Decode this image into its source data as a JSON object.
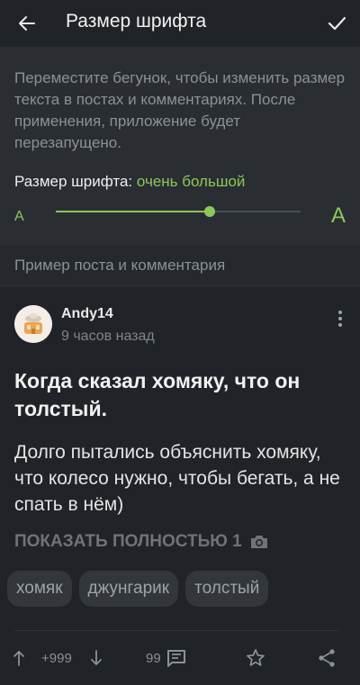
{
  "appbar": {
    "title": "Размер шрифта",
    "back_icon": "arrow-left-icon",
    "confirm_icon": "check-icon"
  },
  "settings": {
    "description": "Переместите бегунок, чтобы изменить размер текста в постах и комментариях. После применения, приложение будет перезапущено.",
    "size_label": "Размер шрифта:",
    "size_value": "очень большой",
    "min_glyph": "A",
    "max_glyph": "A",
    "slider_fraction": 0.63,
    "accent": "#8ac858"
  },
  "preview": {
    "section_title": "Пример поста и комментария",
    "author": "Andy14",
    "time": "9 часов назад",
    "title": "Когда сказал хомяку, что он толстый.",
    "body": "Долго пытались объяснить хомяку, что колесо нужно, чтобы бегать, а не спать в нём)",
    "show_more": "ПОКАЗАТЬ ПОЛНОСТЬЮ 1",
    "tags": [
      "хомяк",
      "джунгарик",
      "толстый"
    ],
    "rating": "+999",
    "comments": "99"
  }
}
